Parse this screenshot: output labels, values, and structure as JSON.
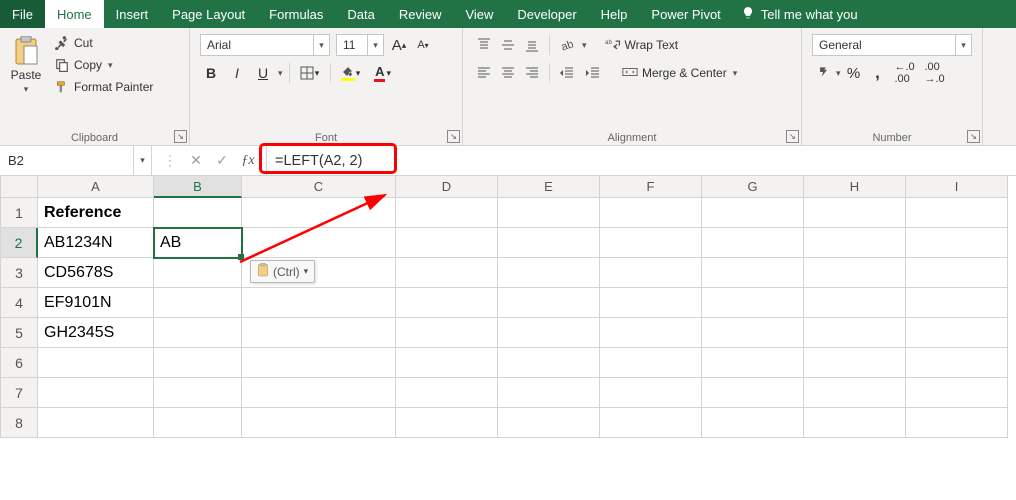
{
  "tabs": {
    "file": "File",
    "home": "Home",
    "insert": "Insert",
    "page_layout": "Page Layout",
    "formulas": "Formulas",
    "data": "Data",
    "review": "Review",
    "view": "View",
    "developer": "Developer",
    "help": "Help",
    "power_pivot": "Power Pivot",
    "tell_me": "Tell me what you"
  },
  "ribbon": {
    "clipboard": {
      "label": "Clipboard",
      "paste": "Paste",
      "cut": "Cut",
      "copy": "Copy",
      "format_painter": "Format Painter"
    },
    "font": {
      "label": "Font",
      "name": "Arial",
      "size": "11"
    },
    "alignment": {
      "label": "Alignment",
      "wrap": "Wrap Text",
      "merge": "Merge & Center"
    },
    "number": {
      "label": "Number",
      "format": "General",
      "dec_inc": ".0",
      "dec_dec": ".00"
    }
  },
  "fx": {
    "namebox": "B2",
    "formula": "=LEFT(A2, 2)"
  },
  "columns": [
    "A",
    "B",
    "C",
    "D",
    "E",
    "F",
    "G",
    "H",
    "I"
  ],
  "rows": [
    "1",
    "2",
    "3",
    "4",
    "5",
    "6",
    "7",
    "8"
  ],
  "cells": {
    "A1": "Reference",
    "A2": "AB1234N",
    "A3": "CD5678S",
    "A4": "EF9101N",
    "A5": "GH2345S",
    "B2": "AB"
  },
  "paste_opts": "(Ctrl)",
  "colors": {
    "brand": "#217346",
    "annotation": "#ff0000"
  }
}
